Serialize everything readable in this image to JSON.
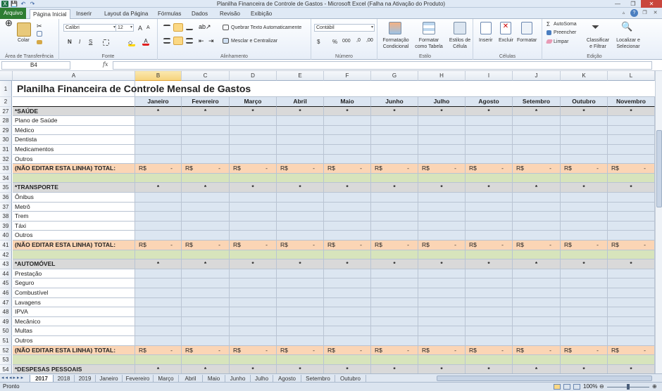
{
  "window": {
    "title": "Planilha Financeira de Controle de Gastos - Microsoft Excel (Falha na Ativação do Produto)",
    "controls": [
      "—",
      "❐",
      "✕"
    ]
  },
  "ribbon_tabs": [
    "Arquivo",
    "Página Inicial",
    "Inserir",
    "Layout da Página",
    "Fórmulas",
    "Dados",
    "Revisão",
    "Exibição"
  ],
  "ribbon": {
    "clipboard": {
      "paste": "Colar",
      "label": "Área de Transferência"
    },
    "font": {
      "name": "Calibri",
      "size": "12",
      "bold": "N",
      "italic": "I",
      "underline": "S",
      "grow": "A",
      "shrink": "A",
      "label": "Fonte"
    },
    "alignment": {
      "wrap": "Quebrar Texto Automaticamente",
      "merge": "Mesclar e Centralizar",
      "label": "Alinhamento"
    },
    "number": {
      "format": "Contábil",
      "currency": "$",
      "percent": "%",
      "thousands": "000",
      "label": "Número"
    },
    "styles": {
      "conditional": "Formatação Condicional",
      "table": "Formatar como Tabela",
      "cell_styles": "Estilos de Célula",
      "label": "Estilo"
    },
    "cells": {
      "insert": "Inserir",
      "delete": "Excluir",
      "format": "Formatar",
      "label": "Células"
    },
    "editing": {
      "autosum": "AutoSoma",
      "fill": "Preencher",
      "clear": "Limpar",
      "sort": "Classificar e Filtrar",
      "find": "Localizar e Selecionar",
      "label": "Edição"
    }
  },
  "formula_bar": {
    "name_box": "B4",
    "fx": "fx",
    "value": ""
  },
  "columns": [
    "A",
    "B",
    "C",
    "D",
    "E",
    "F",
    "G",
    "H",
    "I",
    "J",
    "K",
    "L"
  ],
  "selected_column": "B",
  "sheet_title": "Planilha Financeira de Controle Mensal de Gastos",
  "months": [
    "Janeiro",
    "Fevereiro",
    "Março",
    "Abril",
    "Maio",
    "Junho",
    "Julho",
    "Agosto",
    "Setembro",
    "Outubro",
    "Novembro"
  ],
  "section_marker": "*",
  "total_currency": "R$",
  "total_value": "-",
  "rows": [
    {
      "num": "1",
      "type": "title"
    },
    {
      "num": "2",
      "type": "months"
    },
    {
      "num": "27",
      "type": "section",
      "label": "*SAÚDE"
    },
    {
      "num": "28",
      "type": "item",
      "label": "Plano de Saúde"
    },
    {
      "num": "29",
      "type": "item",
      "label": "Médico"
    },
    {
      "num": "30",
      "type": "item",
      "label": "Dentista"
    },
    {
      "num": "31",
      "type": "item",
      "label": "Medicamentos"
    },
    {
      "num": "32",
      "type": "item",
      "label": "Outros"
    },
    {
      "num": "33",
      "type": "total",
      "label": "(NÃO EDITAR ESTA LINHA)  TOTAL:"
    },
    {
      "num": "34",
      "type": "blank"
    },
    {
      "num": "35",
      "type": "section",
      "label": "*TRANSPORTE"
    },
    {
      "num": "36",
      "type": "item",
      "label": "Ônibus"
    },
    {
      "num": "37",
      "type": "item",
      "label": "Metrô"
    },
    {
      "num": "38",
      "type": "item",
      "label": "Trem"
    },
    {
      "num": "39",
      "type": "item",
      "label": "Táxi"
    },
    {
      "num": "40",
      "type": "item",
      "label": "Outros"
    },
    {
      "num": "41",
      "type": "total",
      "label": "(NÃO EDITAR ESTA LINHA)  TOTAL:"
    },
    {
      "num": "42",
      "type": "blank"
    },
    {
      "num": "43",
      "type": "section",
      "label": "*AUTOMÓVEL"
    },
    {
      "num": "44",
      "type": "item",
      "label": "Prestação"
    },
    {
      "num": "45",
      "type": "item",
      "label": "Seguro"
    },
    {
      "num": "46",
      "type": "item",
      "label": "Combustível"
    },
    {
      "num": "47",
      "type": "item",
      "label": "Lavagens"
    },
    {
      "num": "48",
      "type": "item",
      "label": "IPVA"
    },
    {
      "num": "49",
      "type": "item",
      "label": "Mecânico"
    },
    {
      "num": "50",
      "type": "item",
      "label": "Multas"
    },
    {
      "num": "51",
      "type": "item",
      "label": "Outros"
    },
    {
      "num": "52",
      "type": "total",
      "label": "(NÃO EDITAR ESTA LINHA)  TOTAL:"
    },
    {
      "num": "53",
      "type": "blank"
    },
    {
      "num": "54",
      "type": "section",
      "label": "*DESPESAS PESSOAIS"
    }
  ],
  "sheet_tabs": [
    "2017",
    "2018",
    "2019",
    "Janeiro",
    "Fevereiro",
    "Março",
    "Abril",
    "Maio",
    "Junho",
    "Julho",
    "Agosto",
    "Setembro",
    "Outubro"
  ],
  "active_sheet": "2017",
  "status": {
    "mode": "Pronto",
    "zoom": "100%"
  },
  "colors": {
    "section": "#d9d9d9",
    "total": "#fbd5b5",
    "blank": "#d7e4bc",
    "data": "#dce6f1",
    "header": "#dbe5f1",
    "accent": "#2e7d32"
  }
}
